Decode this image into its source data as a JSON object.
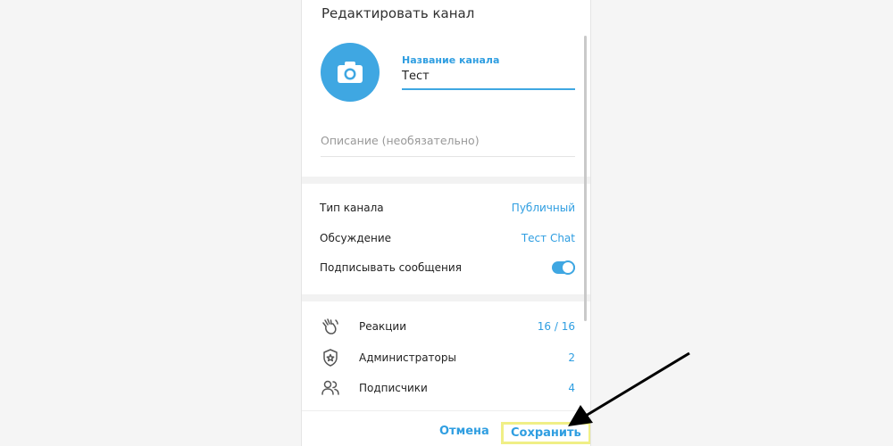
{
  "dialog": {
    "title": "Редактировать канал",
    "name_label": "Название канала",
    "name_value": "Тест",
    "description_placeholder": "Описание (необязательно)"
  },
  "settings": [
    {
      "label": "Тип канала",
      "value": "Публичный"
    },
    {
      "label": "Обсуждение",
      "value": "Тест Chat"
    },
    {
      "label": "Подписывать сообщения",
      "toggle": true
    }
  ],
  "management": [
    {
      "icon": "wave-hand-icon",
      "label": "Реакции",
      "value": "16 / 16"
    },
    {
      "icon": "admin-shield-icon",
      "label": "Администраторы",
      "value": "2"
    },
    {
      "icon": "users-icon",
      "label": "Подписчики",
      "value": "4"
    }
  ],
  "footer": {
    "cancel_label": "Отмена",
    "save_label": "Сохранить"
  },
  "colors": {
    "accent": "#3fa7e2",
    "highlight": "#f0ef86"
  }
}
